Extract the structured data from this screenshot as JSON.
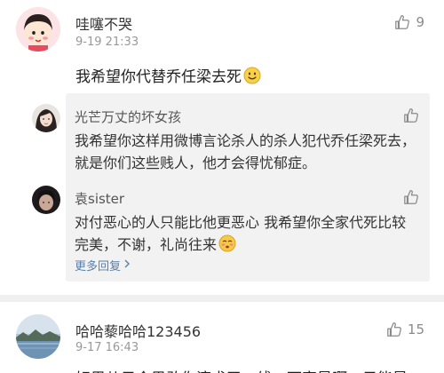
{
  "comments": [
    {
      "user": "哇噻不哭",
      "time": "9-19 21:33",
      "likes": "9",
      "text": "我希望你代替乔任梁去死",
      "emoji": "smile-emoji",
      "replies": [
        {
          "user": "光芒万丈的坏女孩",
          "text": "我希望你这样用微博言论杀人的杀人犯代乔任梁死去，就是你们这些贱人，他才会得忧郁症。"
        },
        {
          "user": "袁sister",
          "text": "对付恶心的人只能比他更恶心 我希望你全家代死比较完美，不谢，礼尚往来",
          "emoji": "blush-emoji"
        }
      ],
      "more_replies": "更多回复"
    },
    {
      "user": "哈哈藜哈哈123456",
      "time": "9-17 16:43",
      "likes": "15",
      "text": "好男儿只会果敢你滚求了一线，下家是啊，只能是"
    }
  ],
  "icons": {
    "like": "thumbs-up-icon",
    "more_arrow": "chevron-right-icon"
  },
  "colors": {
    "name": "#333333",
    "time": "#999999",
    "reply_bg": "#f2f2f2",
    "link": "#5a7fa8"
  }
}
